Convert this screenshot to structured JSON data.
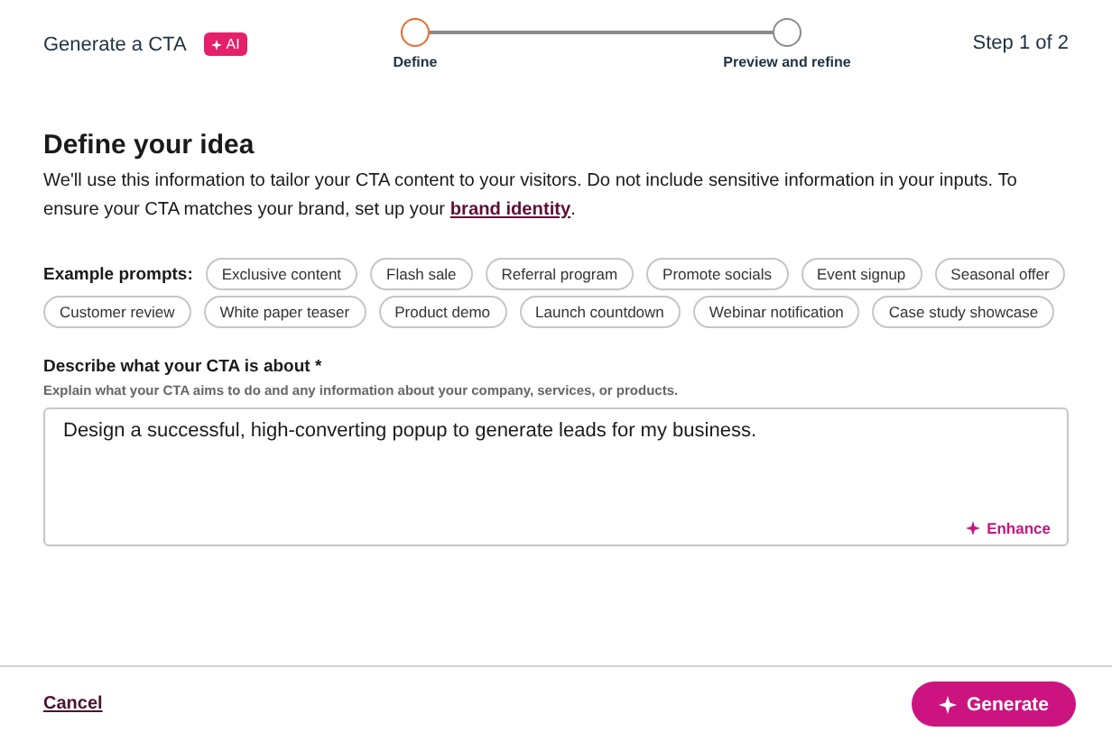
{
  "header": {
    "title": "Generate a CTA",
    "badge": "AI",
    "step_count": "Step 1 of 2"
  },
  "steps": [
    {
      "label": "Define",
      "current": true
    },
    {
      "label": "Preview and refine",
      "current": false
    }
  ],
  "heading": "Define your idea",
  "intro": "We'll use this information to tailor your CTA content to your visitors. Do not include sensitive information in your inputs. To ensure your CTA matches your brand, set up your",
  "intro_link": "brand identity",
  "intro_end": ".",
  "prompts_label": "Example prompts:",
  "prompts": [
    "Exclusive content",
    "Flash sale",
    "Referral program",
    "Promote socials",
    "Event signup",
    "Seasonal offer",
    "Customer review",
    "White paper teaser",
    "Product demo",
    "Launch countdown",
    "Webinar notification",
    "Case study showcase"
  ],
  "description": {
    "label": "Describe what your CTA is about *",
    "hint": "Explain what your CTA aims to do and any information about your company, services, or products.",
    "value": "Design a successful, high-converting popup to generate leads for my business.",
    "enhance": "Enhance"
  },
  "footer": {
    "cancel": "Cancel",
    "generate": "Generate"
  }
}
